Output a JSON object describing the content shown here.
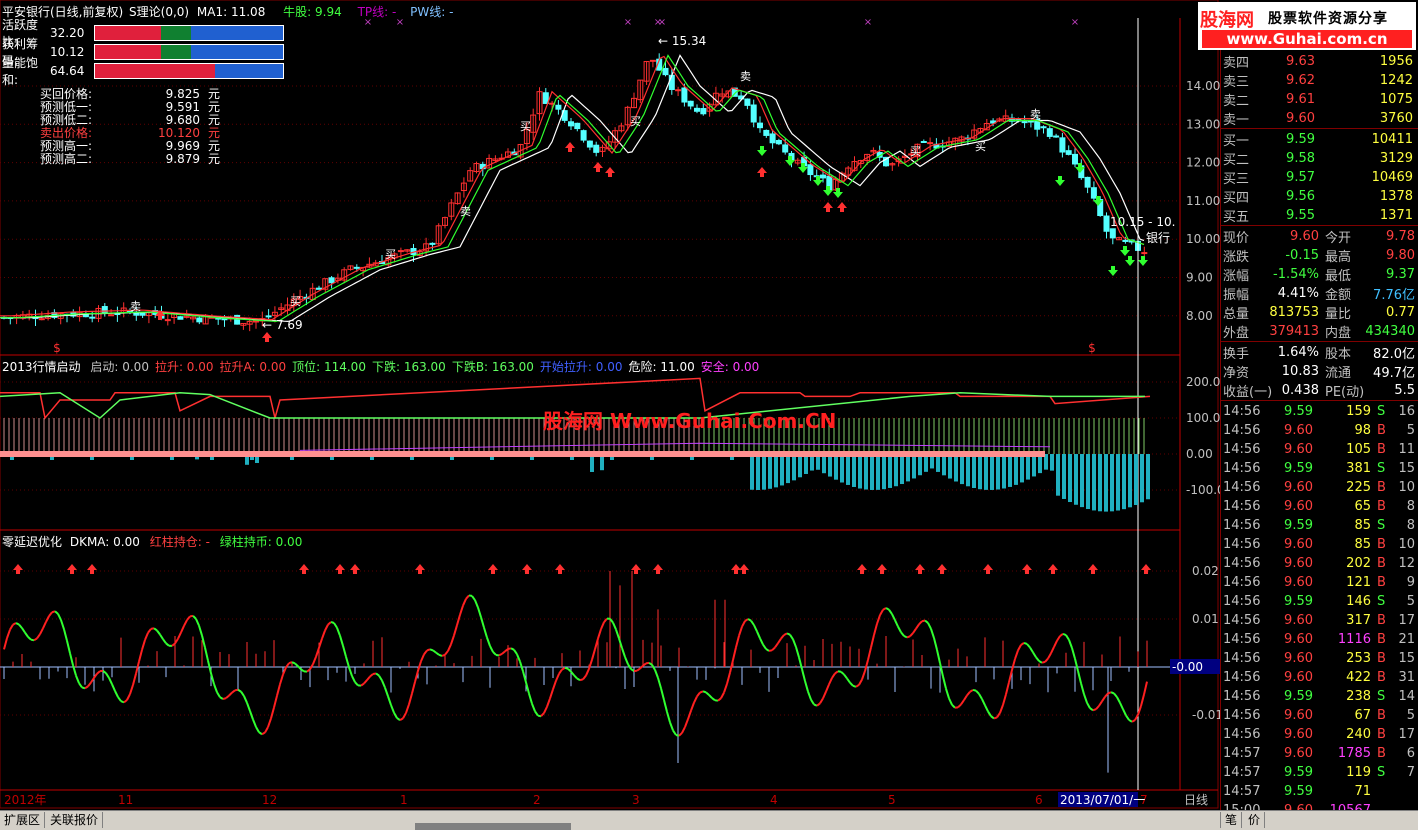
{
  "title_bar": {
    "stock_name": "平安银行(日线,前复权)",
    "theory": "S理论(0,0)",
    "ma": "MA1: 11.08",
    "niu": "牛股: 9.94",
    "tp": "TP线: -",
    "pw": "PW线: -"
  },
  "indicators": [
    {
      "label": "活跃度比:",
      "value": "32.20"
    },
    {
      "label": "获利筹码:",
      "value": "10.12"
    },
    {
      "label": "量能饱和:",
      "value": "64.64"
    }
  ],
  "price_table": [
    {
      "label": "买回价格:",
      "value": "9.825",
      "unit": "元"
    },
    {
      "label": "预测低一:",
      "value": "9.591",
      "unit": "元"
    },
    {
      "label": "预测低二:",
      "value": "9.680",
      "unit": "元"
    },
    {
      "label": "卖出价格:",
      "value": "10.120",
      "unit": "元"
    },
    {
      "label": "预测高一:",
      "value": "9.969",
      "unit": "元"
    },
    {
      "label": "预测高二:",
      "value": "9.879",
      "unit": "元"
    }
  ],
  "main_axis": [
    "14.00",
    "13.00",
    "12.00",
    "11.00",
    "10.00",
    "9.00",
    "8.00"
  ],
  "annotations": {
    "high": "15.34",
    "low": "7.69",
    "last": "10.15 - 10.",
    "stock_tag": "银行",
    "mark_buy": "买",
    "mark_sell": "卖",
    "dollar": "$",
    "cross": "×"
  },
  "panel2": {
    "title": "2013行情启动",
    "items": [
      {
        "label": "启动: 0.00",
        "color": "#c0c0c0"
      },
      {
        "label": "拉升: 0.00",
        "color": "#ff4040"
      },
      {
        "label": "拉升A: 0.00",
        "color": "#ff4040"
      },
      {
        "label": "顶位: 114.00",
        "color": "#60ff60"
      },
      {
        "label": "下跌: 163.00",
        "color": "#60ff60"
      },
      {
        "label": "下跌B: 163.00",
        "color": "#60ff60"
      },
      {
        "label": "开始拉升: 0.00",
        "color": "#4060ff"
      },
      {
        "label": "危险: 11.00",
        "color": "#ffffff"
      },
      {
        "label": "安全: 0.00",
        "color": "#ff40ff"
      }
    ],
    "axis": [
      "200.00",
      "100.00",
      "0.00",
      "-100.00"
    ]
  },
  "watermark": "股海网 Www.Guhai.Com.CN",
  "panel3": {
    "title": "零延迟优化",
    "dkma": "DKMA: 0.00",
    "red": "红柱持仓: -",
    "green": "绿柱持币: 0.00",
    "axis": [
      "0.02",
      "0.01",
      "-0.00",
      "-0.01"
    ]
  },
  "x_axis": {
    "labels": [
      "2012年",
      "11",
      "12",
      "1",
      "2",
      "3",
      "4",
      "5",
      "6",
      "7"
    ],
    "date": "2013/07/01/一",
    "period": "日线"
  },
  "bottom_tabs": [
    "扩展区",
    "关联报价"
  ],
  "bottom_right": [
    "笔",
    "价"
  ],
  "logo": {
    "title": "股海网",
    "subtitle": "股票软件资源分享",
    "url": "www.Guhai.com.cn"
  },
  "quote": {
    "asks": [
      {
        "name": "卖四",
        "price": "9.63",
        "vol": "1956"
      },
      {
        "name": "卖三",
        "price": "9.62",
        "vol": "1242"
      },
      {
        "name": "卖二",
        "price": "9.61",
        "vol": "1075"
      },
      {
        "name": "卖一",
        "price": "9.60",
        "vol": "3760"
      }
    ],
    "bids": [
      {
        "name": "买一",
        "price": "9.59",
        "vol": "10411"
      },
      {
        "name": "买二",
        "price": "9.58",
        "vol": "3129"
      },
      {
        "name": "买三",
        "price": "9.57",
        "vol": "10469"
      },
      {
        "name": "买四",
        "price": "9.56",
        "vol": "1378"
      },
      {
        "name": "买五",
        "price": "9.55",
        "vol": "1371"
      }
    ],
    "stats": [
      {
        "k1": "现价",
        "v1": "9.60",
        "c1": "#ff4040",
        "k2": "今开",
        "v2": "9.78",
        "c2": "#ff4040"
      },
      {
        "k1": "涨跌",
        "v1": "-0.15",
        "c1": "#40ff40",
        "k2": "最高",
        "v2": "9.80",
        "c2": "#ff4040"
      },
      {
        "k1": "涨幅",
        "v1": "-1.54%",
        "c1": "#40ff40",
        "k2": "最低",
        "v2": "9.37",
        "c2": "#40ff40"
      },
      {
        "k1": "振幅",
        "v1": "4.41%",
        "c1": "#ffffff",
        "k2": "金额",
        "v2": "7.76亿",
        "c2": "#40c0ff"
      },
      {
        "k1": "总量",
        "v1": "813753",
        "c1": "#ffff40",
        "k2": "量比",
        "v2": "0.77",
        "c2": "#ffff40"
      },
      {
        "k1": "外盘",
        "v1": "379413",
        "c1": "#ff4040",
        "k2": "内盘",
        "v2": "434340",
        "c2": "#40ff40"
      }
    ],
    "stats2": [
      {
        "k1": "换手",
        "v1": "1.64%",
        "c1": "#ffffff",
        "k2": "股本",
        "v2": "82.0亿",
        "c2": "#ffffff"
      },
      {
        "k1": "净资",
        "v1": "10.83",
        "c1": "#ffffff",
        "k2": "流通",
        "v2": "49.7亿",
        "c2": "#ffffff"
      },
      {
        "k1": "收益(一)",
        "v1": "0.438",
        "c1": "#ffffff",
        "k2": "PE(动)",
        "v2": "5.5",
        "c2": "#ffffff"
      }
    ],
    "ticks": [
      {
        "t": "14:56",
        "p": "9.59",
        "v": "159",
        "s": "S",
        "n": "16"
      },
      {
        "t": "14:56",
        "p": "9.60",
        "v": "98",
        "s": "B",
        "n": "5"
      },
      {
        "t": "14:56",
        "p": "9.60",
        "v": "105",
        "s": "B",
        "n": "11"
      },
      {
        "t": "14:56",
        "p": "9.59",
        "v": "381",
        "s": "S",
        "n": "15"
      },
      {
        "t": "14:56",
        "p": "9.60",
        "v": "225",
        "s": "B",
        "n": "10"
      },
      {
        "t": "14:56",
        "p": "9.60",
        "v": "65",
        "s": "B",
        "n": "8"
      },
      {
        "t": "14:56",
        "p": "9.59",
        "v": "85",
        "s": "S",
        "n": "8"
      },
      {
        "t": "14:56",
        "p": "9.60",
        "v": "85",
        "s": "B",
        "n": "10"
      },
      {
        "t": "14:56",
        "p": "9.60",
        "v": "202",
        "s": "B",
        "n": "12"
      },
      {
        "t": "14:56",
        "p": "9.60",
        "v": "121",
        "s": "B",
        "n": "9"
      },
      {
        "t": "14:56",
        "p": "9.59",
        "v": "146",
        "s": "S",
        "n": "5"
      },
      {
        "t": "14:56",
        "p": "9.60",
        "v": "317",
        "s": "B",
        "n": "17"
      },
      {
        "t": "14:56",
        "p": "9.60",
        "v": "1116",
        "s": "B",
        "n": "21"
      },
      {
        "t": "14:56",
        "p": "9.60",
        "v": "253",
        "s": "B",
        "n": "15"
      },
      {
        "t": "14:56",
        "p": "9.60",
        "v": "422",
        "s": "B",
        "n": "31"
      },
      {
        "t": "14:56",
        "p": "9.59",
        "v": "238",
        "s": "S",
        "n": "14"
      },
      {
        "t": "14:56",
        "p": "9.60",
        "v": "67",
        "s": "B",
        "n": "5"
      },
      {
        "t": "14:56",
        "p": "9.60",
        "v": "240",
        "s": "B",
        "n": "17"
      },
      {
        "t": "14:57",
        "p": "9.60",
        "v": "1785",
        "s": "B",
        "n": "6"
      },
      {
        "t": "14:57",
        "p": "9.59",
        "v": "119",
        "s": "S",
        "n": "7"
      },
      {
        "t": "14:57",
        "p": "9.59",
        "v": "71",
        "s": "",
        "n": ""
      },
      {
        "t": "15:00",
        "p": "9.60",
        "v": "10567",
        "s": "",
        "n": ""
      }
    ]
  },
  "colors": {
    "up": "#ff3030",
    "down": "#54ffff",
    "green": "#40ff40",
    "grid": "#800000",
    "axis": "#c00000"
  }
}
